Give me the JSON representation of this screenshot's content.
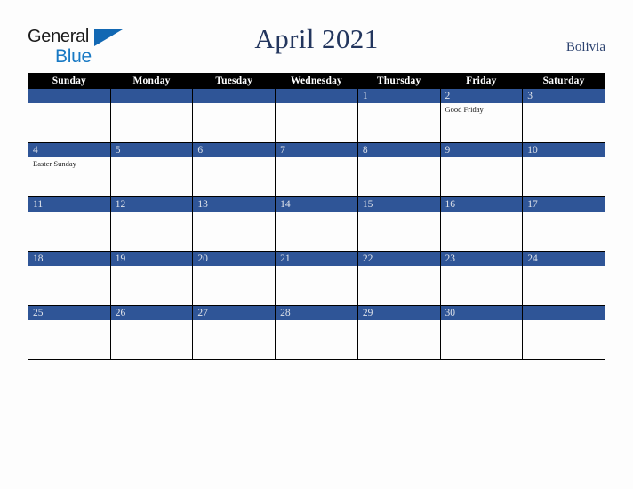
{
  "brand": {
    "name_part1": "General",
    "name_part2": "Blue",
    "triangle_icon": "blue-triangle-icon",
    "accent_color": "#1879c4"
  },
  "header": {
    "title": "April 2021",
    "country": "Bolivia",
    "title_color": "#23365e"
  },
  "calendar": {
    "weekday_headers": [
      "Sunday",
      "Monday",
      "Tuesday",
      "Wednesday",
      "Thursday",
      "Friday",
      "Saturday"
    ],
    "header_bg": "#000000",
    "daybar_bg": "#2f5597",
    "daybar_text_color": "#dfe3ea",
    "weeks": [
      [
        {
          "date": "",
          "events": []
        },
        {
          "date": "",
          "events": []
        },
        {
          "date": "",
          "events": []
        },
        {
          "date": "",
          "events": []
        },
        {
          "date": "1",
          "events": []
        },
        {
          "date": "2",
          "events": [
            "Good Friday"
          ]
        },
        {
          "date": "3",
          "events": []
        }
      ],
      [
        {
          "date": "4",
          "events": [
            "Easter Sunday"
          ]
        },
        {
          "date": "5",
          "events": []
        },
        {
          "date": "6",
          "events": []
        },
        {
          "date": "7",
          "events": []
        },
        {
          "date": "8",
          "events": []
        },
        {
          "date": "9",
          "events": []
        },
        {
          "date": "10",
          "events": []
        }
      ],
      [
        {
          "date": "11",
          "events": []
        },
        {
          "date": "12",
          "events": []
        },
        {
          "date": "13",
          "events": []
        },
        {
          "date": "14",
          "events": []
        },
        {
          "date": "15",
          "events": []
        },
        {
          "date": "16",
          "events": []
        },
        {
          "date": "17",
          "events": []
        }
      ],
      [
        {
          "date": "18",
          "events": []
        },
        {
          "date": "19",
          "events": []
        },
        {
          "date": "20",
          "events": []
        },
        {
          "date": "21",
          "events": []
        },
        {
          "date": "22",
          "events": []
        },
        {
          "date": "23",
          "events": []
        },
        {
          "date": "24",
          "events": []
        }
      ],
      [
        {
          "date": "25",
          "events": []
        },
        {
          "date": "26",
          "events": []
        },
        {
          "date": "27",
          "events": []
        },
        {
          "date": "28",
          "events": []
        },
        {
          "date": "29",
          "events": []
        },
        {
          "date": "30",
          "events": []
        },
        {
          "date": "",
          "events": []
        }
      ]
    ]
  }
}
